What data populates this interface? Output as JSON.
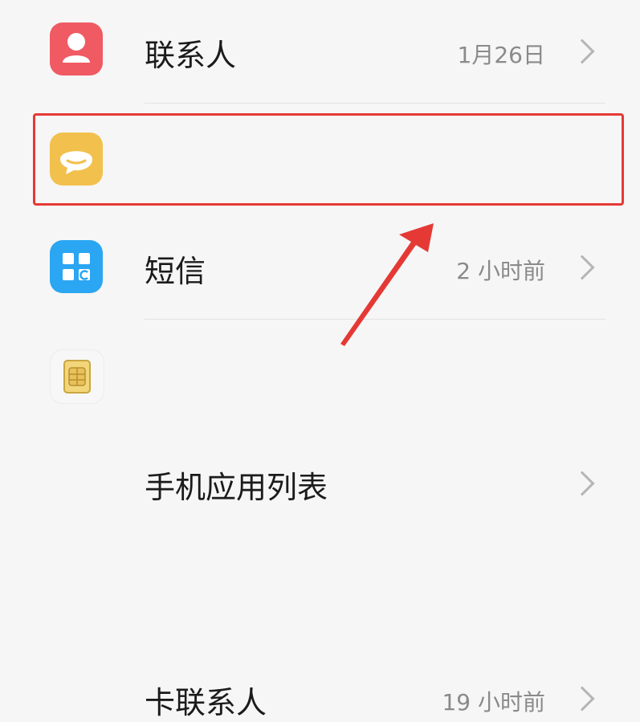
{
  "list": {
    "items": [
      {
        "label": "联系人",
        "time": "1月26日",
        "icon": "contacts-icon"
      },
      {
        "label": "短信",
        "time": "2 小时前",
        "icon": "messages-icon"
      },
      {
        "label": "手机应用列表",
        "time": "",
        "icon": "app-list-icon"
      },
      {
        "label": "卡联系人",
        "time": "19 小时前",
        "icon": "sim-card-icon"
      }
    ]
  },
  "annotation": {
    "highlight_color": "#e53935",
    "highlighted_item": "短信"
  }
}
